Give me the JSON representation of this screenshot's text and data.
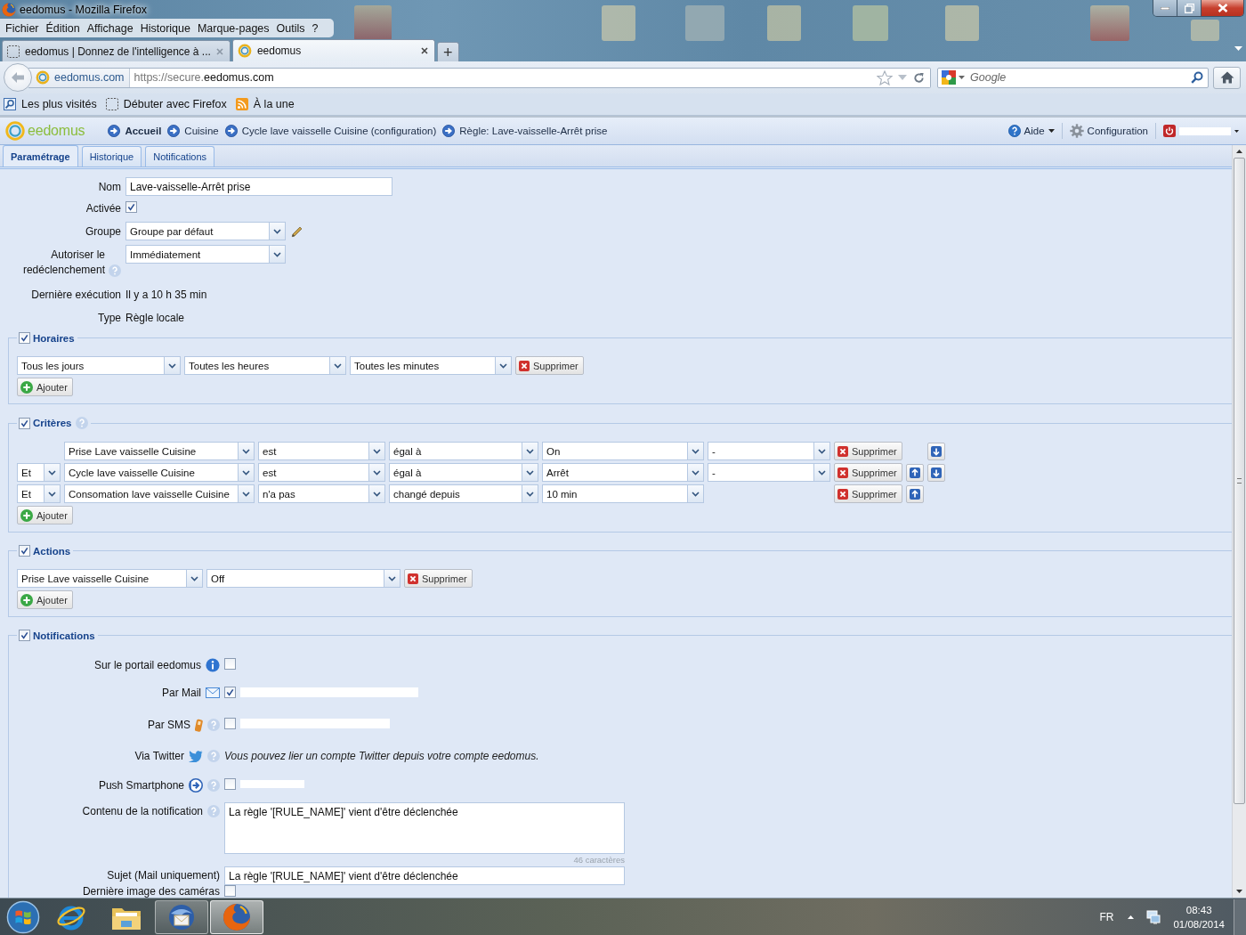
{
  "window": {
    "title": "eedomus - Mozilla Firefox"
  },
  "menu_bar": [
    "Fichier",
    "Édition",
    "Affichage",
    "Historique",
    "Marque-pages",
    "Outils",
    "?"
  ],
  "browser_tabs": [
    {
      "title": "eedomus | Donnez de l'intelligence à ...",
      "kind": "blank",
      "selected": false
    },
    {
      "title": "eedomus",
      "kind": "site",
      "selected": true
    }
  ],
  "new_tab_button": "+",
  "address_bar": {
    "identity": "eedomus.com",
    "url_prefix": "https://secure.",
    "url_domain": "eedomus.com"
  },
  "search_bar": {
    "placeholder": "Google"
  },
  "bookmarks": [
    {
      "label": "Les plus visités",
      "kind": "most-visited"
    },
    {
      "label": "Débuter avec Firefox",
      "kind": "blank"
    },
    {
      "label": "À la une",
      "kind": "feed"
    }
  ],
  "app_header": {
    "logo": "eedomus",
    "breadcrumbs": [
      {
        "label": "Accueil",
        "emphasized": true
      },
      {
        "label": "Cuisine",
        "emphasized": false
      },
      {
        "label": "Cycle lave vaisselle Cuisine (configuration)",
        "emphasized": false
      },
      {
        "label": "Règle: Lave-vaisselle-Arrêt prise",
        "emphasized": false
      }
    ],
    "help_menu": "Aide",
    "settings_link": "Configuration",
    "user_redacted": true
  },
  "tabs": [
    {
      "label": "Paramétrage",
      "selected": true
    },
    {
      "label": "Historique",
      "selected": false
    },
    {
      "label": "Notifications",
      "selected": false
    }
  ],
  "general": [
    {
      "label": "Nom",
      "kind": "text",
      "value": "Lave-vaisselle-Arrêt prise",
      "help": false
    },
    {
      "label": "Activée",
      "kind": "checkbox",
      "checked": true,
      "help": false
    },
    {
      "label": "Groupe",
      "kind": "select",
      "value": "Groupe par défaut",
      "editable": true,
      "help": false
    },
    {
      "label": "Autoriser le redéclenchement",
      "kind": "select",
      "value": "Immédiatement",
      "editable": false,
      "help": true
    },
    {
      "label": "Dernière exécution",
      "kind": "static",
      "value": "Il y a 10 h 35 min",
      "help": false
    },
    {
      "label": "Type",
      "kind": "static",
      "value": "Règle locale",
      "help": false
    }
  ],
  "schedules": {
    "title": "Horaires",
    "enabled": true,
    "help": false,
    "rows": [
      {
        "selects": [
          "Tous les jours",
          "Toutes les heures",
          "Toutes les minutes"
        ],
        "delete": "Supprimer"
      }
    ],
    "add": "Ajouter"
  },
  "criteria": {
    "title": "Critères",
    "enabled": true,
    "help": true,
    "rows": [
      {
        "device": "Prise Lave vaisselle Cuisine",
        "operator": "est",
        "comparator": "égal à",
        "value": "On",
        "extra": "-",
        "delete": "Supprimer",
        "move_up": false,
        "move_down": true
      },
      {
        "conjunction": "Et",
        "device": "Cycle lave vaisselle Cuisine",
        "operator": "est",
        "comparator": "égal à",
        "value": "Arrêt",
        "extra": "-",
        "delete": "Supprimer",
        "move_up": true,
        "move_down": true
      },
      {
        "conjunction": "Et",
        "device": "Consomation lave vaisselle Cuisine",
        "operator": "n'a pas",
        "comparator": "changé depuis",
        "value": "10 min",
        "delete": "Supprimer",
        "move_up": true,
        "move_down": false
      }
    ],
    "add": "Ajouter"
  },
  "actions": {
    "title": "Actions",
    "enabled": true,
    "help": false,
    "rows": [
      {
        "device": "Prise Lave vaisselle Cuisine",
        "value": "Off",
        "delete": "Supprimer"
      }
    ],
    "add": "Ajouter"
  },
  "notifications": {
    "title": "Notifications",
    "enabled": true,
    "help": false,
    "rows": [
      {
        "kind": "portal",
        "label": "Sur le portail eedomus",
        "help": false,
        "checked": false
      },
      {
        "kind": "mail",
        "label": "Par Mail",
        "help": false,
        "checked": true,
        "redacted": true
      },
      {
        "kind": "sms",
        "label": "Par SMS",
        "help": true,
        "checked": false,
        "redacted": true
      },
      {
        "kind": "twitter",
        "label": "Via Twitter",
        "help": true,
        "note": "Vous pouvez lier un compte Twitter depuis votre compte eedomus."
      },
      {
        "kind": "push",
        "label": "Push Smartphone",
        "help": true,
        "checked": false,
        "redacted": true
      },
      {
        "kind": "message",
        "label": "Contenu de la notification",
        "help": true,
        "value": "La règle '[RULE_NAME]' vient d'être déclenchée",
        "counter": "46 caractères"
      },
      {
        "kind": "subject",
        "label": "Sujet (Mail uniquement)",
        "help": false,
        "value": "La règle '[RULE_NAME]' vient d'être déclenchée"
      },
      {
        "kind": "camera",
        "label": "Dernière image des caméras",
        "help": false,
        "checked": false
      }
    ]
  },
  "taskbar": {
    "apps": [
      {
        "kind": "e-browser",
        "running": false,
        "selected": false
      },
      {
        "kind": "folder",
        "running": false,
        "selected": false
      },
      {
        "kind": "mail-client",
        "running": true,
        "selected": false
      },
      {
        "kind": "browser",
        "running": true,
        "selected": true
      }
    ],
    "language": "FR",
    "time": "08:43",
    "date": "01/08/2014"
  }
}
